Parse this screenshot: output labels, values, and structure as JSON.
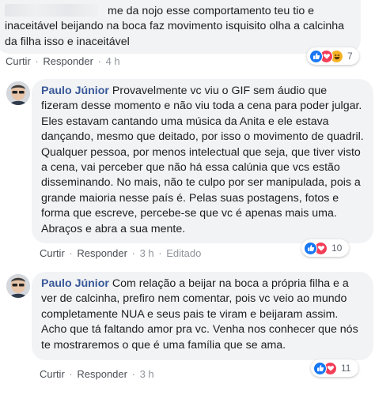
{
  "comments": [
    {
      "author": "",
      "text": "me da nojo esse comportamento teu tio e inaceitável beijando na boca faz movimento isquisito olha a calcinha da filha isso e inaceitável",
      "actions": {
        "like": "Curtir",
        "reply": "Responder",
        "time": "4 h",
        "edited": ""
      },
      "reactions": {
        "icons": [
          "like-icon",
          "love-icon",
          "haha-icon"
        ],
        "count": "7"
      }
    },
    {
      "author": "Paulo Júnior",
      "text": "Provavelmente vc viu o GIF sem áudio que fizeram desse momento e não viu toda a cena para poder julgar. Eles estavam cantando uma música da Anita e ele estava dançando, mesmo que deitado, por isso o movimento de quadril. Qualquer pessoa, por menos intelectual que seja, que tiver visto a cena, vai perceber que não há essa calúnia que vcs estão disseminando. No mais, não te culpo por ser manipulada, pois a grande maioria nesse país é. Pelas suas postagens, fotos e forma que escreve, percebe-se que vc é apenas mais uma. Abraços e abra a sua mente.",
      "actions": {
        "like": "Curtir",
        "reply": "Responder",
        "time": "3 h",
        "edited": "Editado"
      },
      "reactions": {
        "icons": [
          "like-icon",
          "love-icon"
        ],
        "count": "10"
      }
    },
    {
      "author": "Paulo Júnior",
      "text": "Com relação a beijar na boca a própria filha e a ver de calcinha, prefiro nem comentar, pois vc veio ao mundo completamente NUA e seus pais te viram e beijaram assim. Acho que tá faltando amor pra vc. Venha nos conhecer que nós te mostraremos o que é uma família que se ama.",
      "actions": {
        "like": "Curtir",
        "reply": "Responder",
        "time": "3 h",
        "edited": ""
      },
      "reactions": {
        "icons": [
          "like-icon",
          "love-icon"
        ],
        "count": "11"
      }
    }
  ],
  "colors": {
    "link": "#385898",
    "bubble": "#f2f3f5",
    "like": "#1877f2",
    "love": "#f33e58",
    "haha": "#f7b125"
  }
}
